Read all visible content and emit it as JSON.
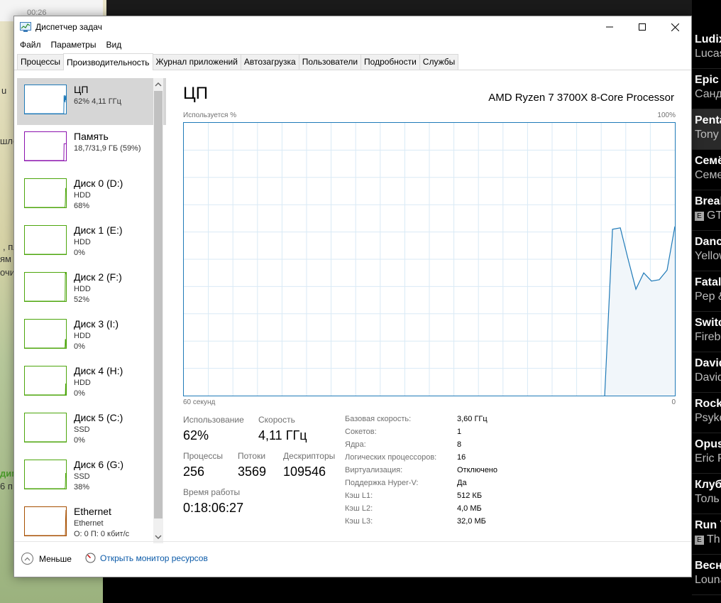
{
  "window": {
    "title": "Диспетчер задач",
    "menu": [
      "Файл",
      "Параметры",
      "Вид"
    ],
    "tabs": [
      "Процессы",
      "Производительность",
      "Журнал приложений",
      "Автозагрузка",
      "Пользователи",
      "Подробности",
      "Службы"
    ],
    "active_tab": "Производительность"
  },
  "sidebar": [
    {
      "name": "ЦП",
      "l2": "62% 4,11 ГГц",
      "l3": "",
      "color": "#1f7ab8",
      "values": [
        0,
        0,
        0,
        0,
        0,
        0,
        0,
        0,
        0,
        0,
        0,
        0,
        0,
        0,
        0,
        0,
        0,
        0,
        0,
        0,
        0,
        0,
        0,
        0,
        0,
        0,
        0,
        0,
        0,
        0,
        0,
        0,
        0,
        0,
        0,
        0,
        0,
        0,
        0,
        0,
        0,
        0,
        0,
        0,
        0,
        0,
        0,
        0,
        0,
        0,
        0,
        0,
        0,
        0,
        0,
        0,
        0,
        0,
        0,
        0,
        0,
        0,
        0,
        0,
        0,
        0,
        0,
        0,
        0,
        0,
        0,
        0,
        0,
        0,
        0,
        0,
        0,
        0,
        0,
        0,
        0,
        0,
        0,
        0,
        0,
        0,
        0,
        0,
        0,
        0,
        0,
        0,
        0,
        0,
        0,
        0,
        0,
        0,
        0,
        0,
        0,
        0,
        0,
        0,
        0,
        0,
        0,
        0,
        0,
        0,
        0,
        0,
        0,
        0,
        0,
        0,
        0,
        0,
        0,
        0,
        0,
        0,
        62,
        65,
        45,
        40,
        62,
        48,
        65
      ]
    },
    {
      "name": "Память",
      "l2": "18,7/31,9 ГБ (59%)",
      "l3": "",
      "color": "#8b12ae",
      "values": [
        0,
        0,
        0,
        0,
        0,
        0,
        0,
        0,
        0,
        0,
        0,
        0,
        0,
        0,
        0,
        0,
        0,
        0,
        0,
        0,
        0,
        0,
        0,
        0,
        0,
        0,
        0,
        0,
        0,
        0,
        0,
        0,
        0,
        0,
        0,
        0,
        0,
        0,
        0,
        0,
        0,
        0,
        0,
        0,
        0,
        0,
        0,
        0,
        0,
        0,
        0,
        0,
        0,
        0,
        0,
        0,
        0,
        0,
        0,
        0,
        0,
        0,
        0,
        0,
        0,
        0,
        0,
        0,
        0,
        0,
        0,
        0,
        0,
        0,
        0,
        0,
        0,
        0,
        0,
        0,
        0,
        0,
        0,
        0,
        0,
        0,
        0,
        0,
        0,
        0,
        0,
        0,
        0,
        0,
        0,
        0,
        0,
        0,
        0,
        0,
        0,
        0,
        0,
        0,
        0,
        0,
        0,
        0,
        0,
        0,
        0,
        0,
        0,
        0,
        0,
        0,
        0,
        0,
        0,
        0,
        0,
        0,
        0,
        59,
        59,
        59,
        59,
        59,
        59,
        59
      ]
    },
    {
      "name": "Диск 0 (D:)",
      "l2": "HDD",
      "l3": "68%",
      "color": "#4da60c",
      "values": [
        0,
        0,
        0,
        0,
        0,
        0,
        0,
        0,
        0,
        0,
        0,
        0,
        0,
        0,
        0,
        0,
        0,
        0,
        0,
        0,
        0,
        0,
        0,
        0,
        0,
        0,
        0,
        0,
        0,
        0,
        0,
        0,
        0,
        0,
        0,
        0,
        0,
        0,
        0,
        0,
        0,
        0,
        0,
        0,
        0,
        0,
        0,
        0,
        0,
        0,
        0,
        0,
        0,
        0,
        0,
        0,
        0,
        0,
        0,
        0,
        0,
        0,
        0,
        0,
        0,
        0,
        0,
        0,
        0,
        0,
        0,
        0,
        0,
        0,
        0,
        0,
        0,
        0,
        0,
        0,
        0,
        0,
        0,
        0,
        0,
        0,
        0,
        0,
        0,
        0,
        0,
        0,
        0,
        0,
        0,
        0,
        0,
        0,
        0,
        0,
        0,
        0,
        0,
        0,
        0,
        0,
        0,
        0,
        0,
        0,
        0,
        0,
        0,
        0,
        0,
        0,
        0,
        0,
        0,
        0,
        0,
        0,
        0,
        0,
        0,
        0,
        20,
        68,
        55
      ]
    },
    {
      "name": "Диск 1 (E:)",
      "l2": "HDD",
      "l3": "0%",
      "color": "#4da60c",
      "values": [
        0,
        0,
        0,
        0,
        0,
        0,
        0,
        0,
        0,
        0
      ]
    },
    {
      "name": "Диск 2 (F:)",
      "l2": "HDD",
      "l3": "52%",
      "color": "#4da60c",
      "values": [
        0,
        0,
        0,
        0,
        0,
        0,
        0,
        0,
        0,
        0,
        0,
        0,
        0,
        0,
        0,
        0,
        0,
        0,
        0,
        0,
        0,
        0,
        0,
        0,
        0,
        0,
        0,
        0,
        0,
        0,
        0,
        0,
        0,
        0,
        0,
        0,
        0,
        0,
        0,
        0,
        0,
        0,
        0,
        0,
        0,
        0,
        0,
        0,
        0,
        0,
        0,
        0,
        0,
        0,
        0,
        0,
        0,
        0,
        0,
        0,
        0,
        0,
        0,
        0,
        0,
        0,
        0,
        0,
        0,
        0,
        0,
        0,
        0,
        0,
        0,
        0,
        0,
        0,
        0,
        0,
        0,
        0,
        0,
        0,
        0,
        0,
        0,
        0,
        0,
        0,
        0,
        0,
        0,
        0,
        0,
        0,
        0,
        0,
        0,
        0,
        0,
        0,
        0,
        0,
        0,
        0,
        0,
        0,
        0,
        0,
        0,
        0,
        0,
        0,
        0,
        0,
        0,
        0,
        0,
        0,
        0,
        0,
        0,
        0,
        0,
        0,
        100,
        95,
        100
      ]
    },
    {
      "name": "Диск 3 (I:)",
      "l2": "HDD",
      "l3": "0%",
      "color": "#4da60c",
      "values": [
        0,
        0,
        0,
        0,
        0,
        0,
        0,
        0,
        0,
        0,
        0,
        0,
        0,
        0,
        0,
        0,
        0,
        0,
        0,
        0,
        0,
        0,
        0,
        0,
        0,
        0,
        0,
        0,
        0,
        0,
        0,
        0,
        0,
        0,
        0,
        0,
        0,
        0,
        0,
        0,
        0,
        0,
        0,
        0,
        0,
        0,
        0,
        0,
        0,
        0,
        0,
        0,
        0,
        0,
        0,
        0,
        0,
        0,
        0,
        0,
        0,
        0,
        0,
        0,
        0,
        0,
        0,
        0,
        0,
        0,
        0,
        0,
        0,
        0,
        0,
        0,
        0,
        0,
        0,
        0,
        0,
        0,
        0,
        0,
        0,
        0,
        0,
        0,
        0,
        0,
        0,
        0,
        0,
        0,
        0,
        0,
        0,
        0,
        0,
        0,
        0,
        0,
        0,
        0,
        0,
        0,
        0,
        0,
        0,
        0,
        0,
        0,
        0,
        0,
        0,
        0,
        0,
        0,
        0,
        0,
        0,
        0,
        0,
        0,
        0,
        0,
        30,
        30,
        0
      ]
    },
    {
      "name": "Диск 4 (H:)",
      "l2": "HDD",
      "l3": "0%",
      "color": "#4da60c",
      "values": [
        0,
        0,
        0,
        0,
        0,
        0,
        0,
        0,
        0,
        0,
        0,
        0,
        0,
        0,
        0,
        0,
        0,
        0,
        0,
        0,
        0,
        0,
        0,
        0,
        0,
        0,
        0,
        0,
        0,
        0,
        0,
        0,
        0,
        0,
        0,
        0,
        0,
        0,
        0,
        0,
        0,
        0,
        0,
        0,
        0,
        0,
        0,
        0,
        0,
        0,
        0,
        0,
        0,
        0,
        0,
        0,
        0,
        0,
        0,
        0,
        0,
        0,
        0,
        0,
        0,
        0,
        0,
        0,
        0,
        0,
        0,
        0,
        0,
        0,
        0,
        0,
        0,
        0,
        0,
        0,
        0,
        0,
        0,
        0,
        0,
        0,
        0,
        0,
        0,
        0,
        0,
        0,
        0,
        0,
        0,
        0,
        0,
        0,
        0,
        0,
        0,
        0,
        0,
        0,
        0,
        0,
        0,
        0,
        0,
        0,
        0,
        0,
        0,
        0,
        0,
        0,
        0,
        0,
        0,
        0,
        0,
        0,
        0,
        0,
        0,
        0,
        0,
        40,
        0
      ]
    },
    {
      "name": "Диск 5 (C:)",
      "l2": "SSD",
      "l3": "0%",
      "color": "#4da60c",
      "values": [
        0,
        0,
        0,
        0,
        0,
        0,
        0,
        0,
        0,
        0
      ]
    },
    {
      "name": "Диск 6 (G:)",
      "l2": "SSD",
      "l3": "38%",
      "color": "#4da60c",
      "values": [
        0,
        0,
        0,
        0,
        0,
        0,
        0,
        0,
        0,
        0,
        0,
        0,
        0,
        0,
        0,
        0,
        0,
        0,
        0,
        0,
        0,
        0,
        0,
        0,
        0,
        0,
        0,
        0,
        0,
        0,
        0,
        0,
        0,
        0,
        0,
        0,
        0,
        0,
        0,
        0,
        0,
        0,
        0,
        0,
        0,
        0,
        0,
        0,
        0,
        0,
        0,
        0,
        0,
        0,
        0,
        0,
        0,
        0,
        0,
        0,
        0,
        0,
        0,
        0,
        0,
        0,
        0,
        0,
        0,
        0,
        0,
        0,
        0,
        0,
        0,
        0,
        0,
        0,
        0,
        0,
        0,
        0,
        0,
        0,
        0,
        0,
        0,
        0,
        0,
        0,
        0,
        0,
        0,
        0,
        0,
        0,
        0,
        0,
        0,
        0,
        0,
        0,
        0,
        0,
        0,
        0,
        0,
        0,
        0,
        0,
        0,
        0,
        0,
        0,
        0,
        0,
        0,
        0,
        0,
        0,
        0,
        0,
        0,
        0,
        0,
        0,
        10,
        55,
        38
      ]
    },
    {
      "name": "Ethernet",
      "l2": "Ethernet",
      "l3": "О: 0 П: 0 кбит/с",
      "color": "#a74f01",
      "values": [
        0,
        0,
        0,
        0,
        0,
        0,
        0,
        0,
        0,
        0,
        0,
        0,
        0,
        0,
        0,
        0,
        0,
        0,
        0,
        0,
        0,
        0,
        0,
        0,
        0,
        0,
        0,
        0,
        0,
        0,
        0,
        0,
        0,
        0,
        0,
        0,
        0,
        0,
        0,
        0,
        0,
        0,
        0,
        0,
        0,
        0,
        0,
        0,
        0,
        0,
        0,
        0,
        0,
        0,
        0,
        0,
        0,
        0,
        0,
        0,
        0,
        0,
        0,
        0,
        0,
        0,
        0,
        0,
        0,
        0,
        0,
        0,
        0,
        0,
        0,
        0,
        0,
        0,
        0,
        0,
        0,
        0,
        0,
        0,
        0,
        0,
        0,
        0,
        0,
        0,
        0,
        0,
        0,
        0,
        0,
        0,
        0,
        0,
        0,
        0,
        0,
        0,
        0,
        0,
        0,
        0,
        0,
        0,
        0,
        0,
        0,
        0,
        0,
        0,
        0,
        0,
        0,
        0,
        0,
        0,
        0,
        0,
        0,
        0,
        0,
        0,
        0,
        60,
        90
      ]
    }
  ],
  "main": {
    "title": "ЦП",
    "model": "AMD Ryzen 7 3700X 8-Core Processor",
    "y_label": "Используется %",
    "y_max_label": "100%",
    "x_left_label": "60 секунд",
    "x_right_label": "0",
    "stats": {
      "usage_label": "Использование",
      "usage": "62%",
      "speed_label": "Скорость",
      "speed": "4,11 ГГц",
      "proc_label": "Процессы",
      "proc": "256",
      "threads_label": "Потоки",
      "threads": "3569",
      "handles_label": "Дескрипторы",
      "handles": "109546",
      "uptime_label": "Время работы",
      "uptime": "0:18:06:27"
    },
    "specs": [
      {
        "k": "Базовая скорость:",
        "v": "3,60 ГГц"
      },
      {
        "k": "Сокетов:",
        "v": "1"
      },
      {
        "k": "Ядра:",
        "v": "8"
      },
      {
        "k": "Логических процессоров:",
        "v": "16"
      },
      {
        "k": "Виртуализация:",
        "v": "Отключено"
      },
      {
        "k": "Поддержка Hyper-V:",
        "v": "Да"
      },
      {
        "k": "Кэш L1:",
        "v": "512 КБ"
      },
      {
        "k": "Кэш L2:",
        "v": "4,0 МБ"
      },
      {
        "k": "Кэш L3:",
        "v": "32,0 МБ"
      }
    ]
  },
  "footer": {
    "less_label": "Меньше",
    "monitor_label": "Открыть монитор ресурсов"
  },
  "chart_data": {
    "type": "area",
    "title": "ЦП",
    "ylabel": "Используется %",
    "xlabel": "60 секунд",
    "ylim": [
      0,
      100
    ],
    "x": [
      60,
      59,
      58,
      57,
      56,
      55,
      54,
      53,
      52,
      51,
      50,
      49,
      48,
      47,
      46,
      45,
      44,
      43,
      42,
      41,
      40,
      39,
      38,
      37,
      36,
      35,
      34,
      33,
      32,
      31,
      30,
      29,
      28,
      27,
      26,
      25,
      24,
      23,
      22,
      21,
      20,
      19,
      18,
      17,
      16,
      15,
      14,
      13,
      12,
      11,
      10,
      9,
      8,
      7,
      6,
      5,
      4,
      3,
      2,
      1,
      0
    ],
    "series": [
      {
        "name": "ЦП",
        "values": [
          0,
          0,
          0,
          0,
          0,
          0,
          0,
          0,
          0,
          0,
          0,
          0,
          0,
          0,
          0,
          0,
          0,
          0,
          0,
          0,
          0,
          0,
          0,
          0,
          0,
          0,
          0,
          0,
          0,
          0,
          0,
          0,
          0,
          0,
          0,
          0,
          0,
          0,
          0,
          0,
          0,
          0,
          0,
          0,
          0,
          0,
          0,
          0,
          0,
          0,
          0,
          0,
          0,
          0,
          0,
          61,
          61.5,
          50,
          39,
          45,
          42,
          42.5,
          46,
          62
        ]
      }
    ]
  },
  "background": {
    "left_fragments": [
      "00:26",
      "u",
      "шло",
      ", пл",
      "ям",
      "очи",
      "дим",
      "6 п"
    ],
    "right_items": [
      {
        "t": "Ludix",
        "a": "Lucas"
      },
      {
        "t": "Epic",
        "a": "Санд"
      },
      {
        "t": "Penta",
        "a": "Tony"
      },
      {
        "t": "Семё",
        "a": "Семе"
      },
      {
        "t": "Break",
        "a": "GT",
        "explicit": true
      },
      {
        "t": "Danc",
        "a": "Yellow"
      },
      {
        "t": "Fatali",
        "a": "Pep &"
      },
      {
        "t": "Switc",
        "a": "Firebo"
      },
      {
        "t": "David",
        "a": "David"
      },
      {
        "t": "Rock",
        "a": "Psyko"
      },
      {
        "t": "Opus",
        "a": "Eric P"
      },
      {
        "t": "Клуб",
        "a": "Толь"
      },
      {
        "t": "Run Y",
        "a": "Th",
        "explicit": true
      },
      {
        "t": "Весн",
        "a": "Louna"
      }
    ],
    "explicit_badge": "E"
  }
}
